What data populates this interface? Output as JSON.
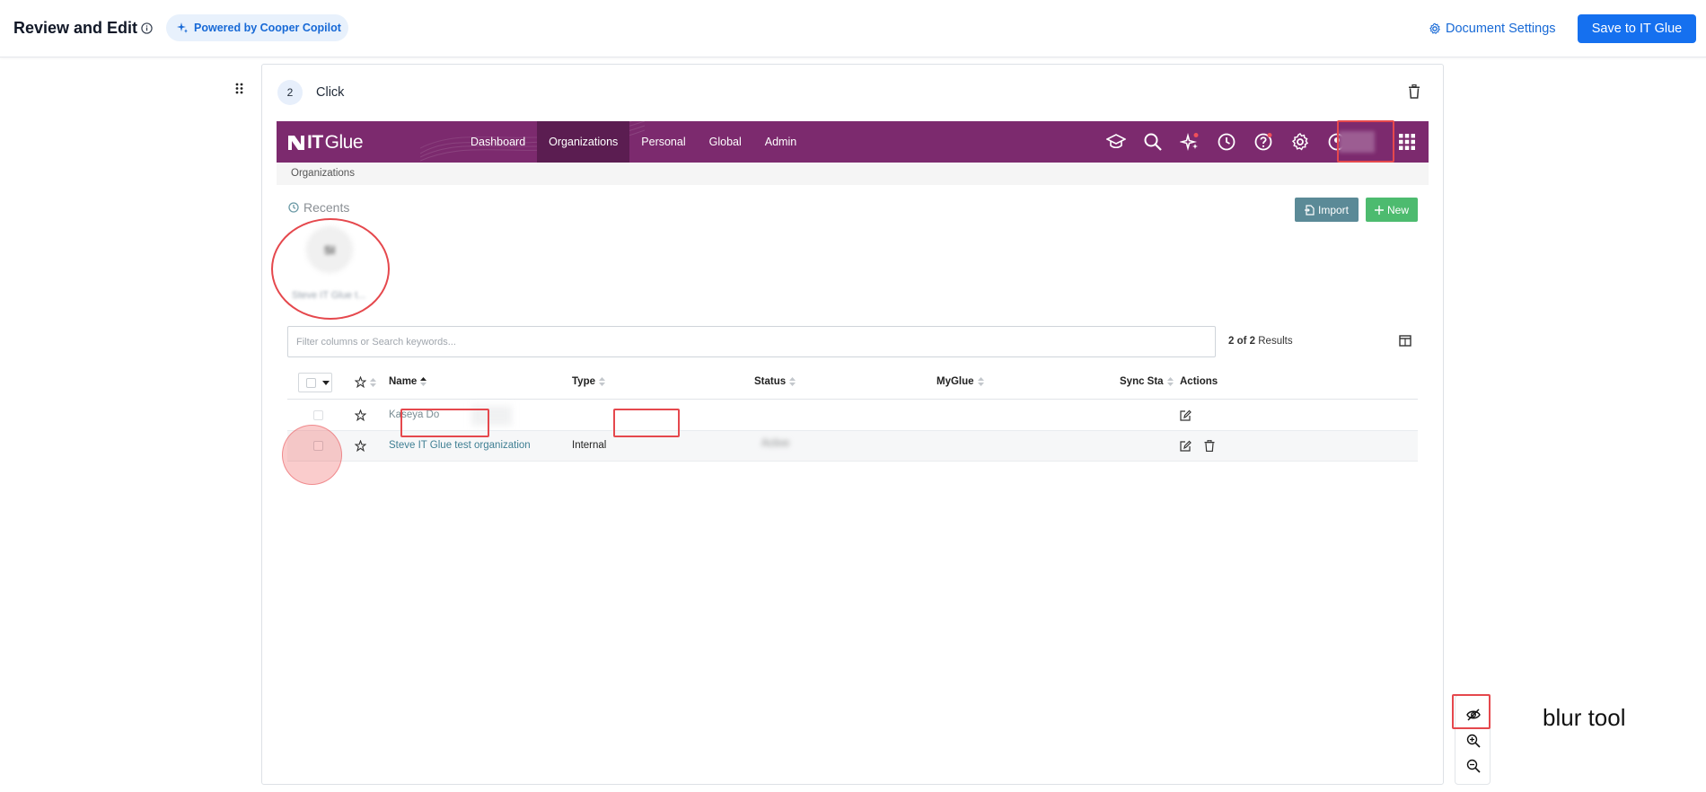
{
  "header": {
    "title": "Review and Edit",
    "copilot_badge": "Powered by Cooper Copilot",
    "doc_settings_label": "Document Settings",
    "save_label": "Save to IT Glue"
  },
  "step": {
    "number": "2",
    "action": "Click"
  },
  "itglue": {
    "logo_strong": "IT",
    "logo_light": "Glue",
    "nav": [
      "Dashboard",
      "Organizations",
      "Personal",
      "Global",
      "Admin"
    ],
    "active_nav": "Organizations",
    "nav_icons": [
      "graduation-cap-icon",
      "search-icon",
      "sparkle-icon",
      "clock-icon",
      "help-icon",
      "gear-icon",
      "user-icon",
      "apps-grid-icon"
    ],
    "breadcrumb": "Organizations",
    "recents_title": "Recents",
    "import_label": "Import",
    "new_label": "New",
    "recent_item": {
      "initials": "SI",
      "name": "Steve IT Glue t..."
    },
    "search_placeholder": "Filter columns or Search keywords...",
    "results": {
      "count": "2 of 2",
      "label": "Results"
    },
    "columns": [
      "Name",
      "Type",
      "Status",
      "MyGlue",
      "Sync Sta",
      "Actions"
    ],
    "rows": [
      {
        "name": "Kaseya Do",
        "type": "",
        "status": ""
      },
      {
        "name": "Steve IT Glue test organization",
        "type": "Internal",
        "status": "Active"
      }
    ]
  },
  "annotation": {
    "tool_label": "blur tool"
  },
  "colors": {
    "accent": "#1570ef",
    "itglue_purple": "#7c2a6e",
    "highlight_red": "#e5484d"
  }
}
